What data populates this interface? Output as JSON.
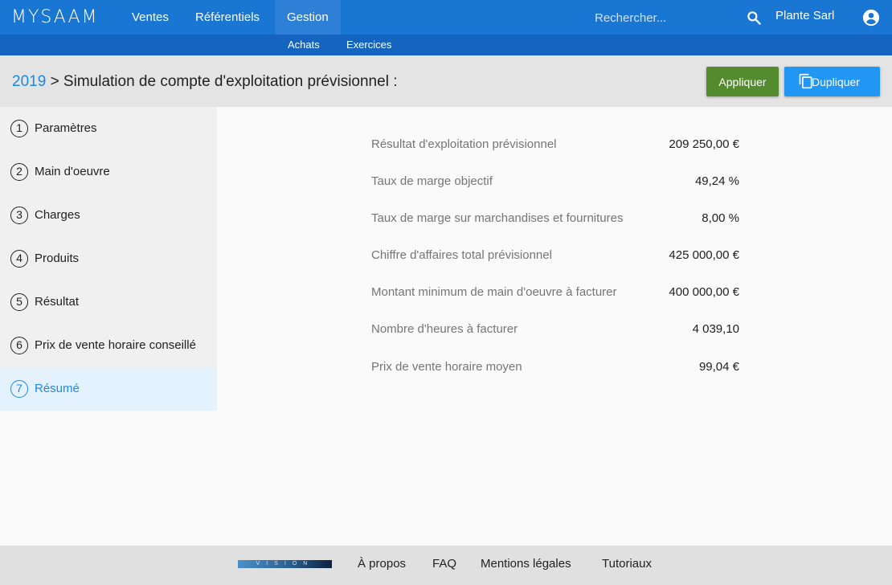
{
  "nav": {
    "logo": "MYSAAM",
    "items": [
      "Ventes",
      "Référentiels",
      "Gestion"
    ],
    "search_placeholder": "Rechercher...",
    "company": "Plante Sarl",
    "sub_items": [
      "Achats",
      "Exercices"
    ],
    "colors": {
      "primary": "#1976d2",
      "sub": "#1565c0"
    }
  },
  "header": {
    "year": "2019",
    "title": "> Simulation de compte d'exploitation prévisionnel :",
    "apply_label": "Appliquer",
    "duplicate_label": "Dupliquer",
    "colors": {
      "apply": "#558b2f",
      "duplicate": "#2196f3"
    }
  },
  "steps": [
    {
      "num": "1",
      "label": "Paramètres"
    },
    {
      "num": "2",
      "label": "Main d'oeuvre"
    },
    {
      "num": "3",
      "label": "Charges"
    },
    {
      "num": "4",
      "label": "Produits"
    },
    {
      "num": "5",
      "label": "Résultat"
    },
    {
      "num": "6",
      "label": "Prix de vente horaire conseillé"
    },
    {
      "num": "7",
      "label": "Résumé"
    }
  ],
  "summary": [
    {
      "label": "Résultat d'exploitation prévisionnel",
      "value": "209 250,00 €"
    },
    {
      "label": "Taux de marge objectif",
      "value": "49,24 %"
    },
    {
      "label": "Taux de marge sur marchandises et fournitures",
      "value": "8,00 %"
    },
    {
      "label": "Chiffre d'affaires total prévisionnel",
      "value": "425 000,00 €"
    },
    {
      "label": "Montant minimum de main d'oeuvre à facturer",
      "value": "400 000,00 €"
    },
    {
      "label": "Nombre d'heures à facturer",
      "value": "4 039,10"
    },
    {
      "label": "Prix de vente horaire moyen",
      "value": "99,04 €"
    }
  ],
  "footer": {
    "brand": "VISION",
    "links": [
      "À propos",
      "FAQ",
      "Mentions légales",
      "Tutoriaux"
    ]
  }
}
